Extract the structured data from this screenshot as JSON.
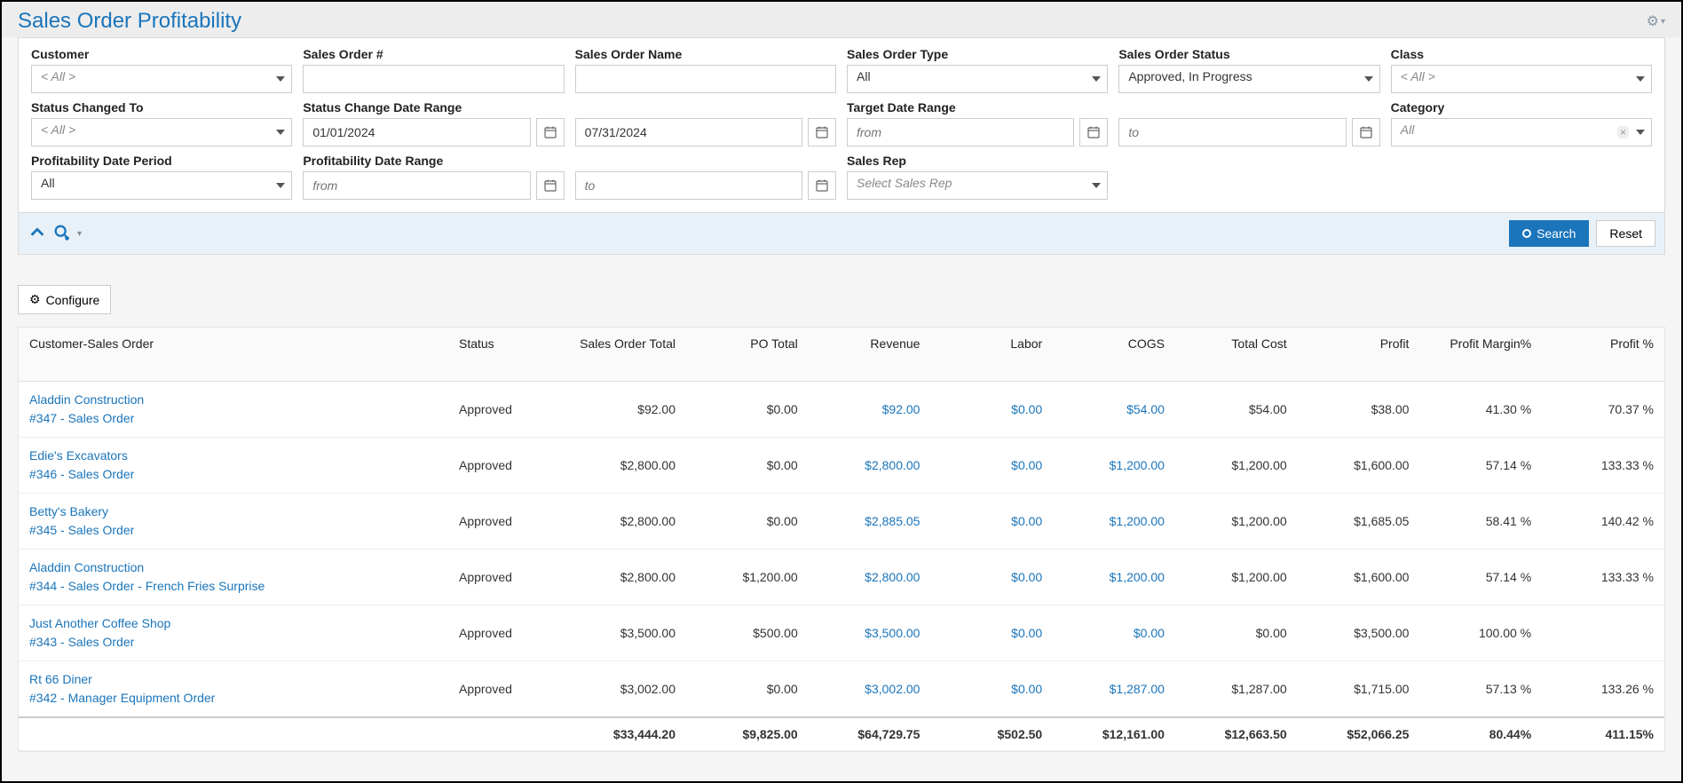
{
  "page": {
    "title": "Sales Order Profitability"
  },
  "filters": {
    "customer": {
      "label": "Customer",
      "value": "< All >"
    },
    "so_number": {
      "label": "Sales Order #",
      "value": ""
    },
    "so_name": {
      "label": "Sales Order Name",
      "value": ""
    },
    "so_type": {
      "label": "Sales Order Type",
      "value": "All"
    },
    "so_status": {
      "label": "Sales Order Status",
      "value": "Approved, In Progress"
    },
    "klass": {
      "label": "Class",
      "value": "< All >"
    },
    "status_changed_to": {
      "label": "Status Changed To",
      "value": "< All >"
    },
    "status_change_range": {
      "label": "Status Change Date Range",
      "from": "01/01/2024",
      "to": "07/31/2024"
    },
    "target_range": {
      "label": "Target Date Range",
      "from_ph": "from",
      "to_ph": "to"
    },
    "category": {
      "label": "Category",
      "value": "All"
    },
    "profit_period": {
      "label": "Profitability Date Period",
      "value": "All"
    },
    "profit_range": {
      "label": "Profitability Date Range",
      "from_ph": "from",
      "to_ph": "to"
    },
    "sales_rep": {
      "label": "Sales Rep",
      "placeholder": "Select Sales Rep"
    }
  },
  "buttons": {
    "search": "Search",
    "reset": "Reset",
    "configure": "Configure"
  },
  "columns": {
    "customer_order": "Customer-Sales Order",
    "status": "Status",
    "so_total": "Sales Order Total",
    "po_total": "PO Total",
    "revenue": "Revenue",
    "labor": "Labor",
    "cogs": "COGS",
    "total_cost": "Total Cost",
    "profit": "Profit",
    "profit_margin": "Profit Margin%",
    "profit_pct": "Profit %"
  },
  "rows": [
    {
      "customer": "Aladdin Construction",
      "order": "#347 - Sales Order",
      "status": "Approved",
      "so_total": "$92.00",
      "po_total": "$0.00",
      "revenue": "$92.00",
      "labor": "$0.00",
      "cogs": "$54.00",
      "total_cost": "$54.00",
      "profit": "$38.00",
      "margin": "41.30 %",
      "pct": "70.37 %"
    },
    {
      "customer": "Edie's Excavators",
      "order": "#346 - Sales Order",
      "status": "Approved",
      "so_total": "$2,800.00",
      "po_total": "$0.00",
      "revenue": "$2,800.00",
      "labor": "$0.00",
      "cogs": "$1,200.00",
      "total_cost": "$1,200.00",
      "profit": "$1,600.00",
      "margin": "57.14 %",
      "pct": "133.33 %"
    },
    {
      "customer": "Betty's Bakery",
      "order": "#345 - Sales Order",
      "status": "Approved",
      "so_total": "$2,800.00",
      "po_total": "$0.00",
      "revenue": "$2,885.05",
      "labor": "$0.00",
      "cogs": "$1,200.00",
      "total_cost": "$1,200.00",
      "profit": "$1,685.05",
      "margin": "58.41 %",
      "pct": "140.42 %"
    },
    {
      "customer": "Aladdin Construction",
      "order": "#344 - Sales Order - French Fries Surprise",
      "status": "Approved",
      "so_total": "$2,800.00",
      "po_total": "$1,200.00",
      "revenue": "$2,800.00",
      "labor": "$0.00",
      "cogs": "$1,200.00",
      "total_cost": "$1,200.00",
      "profit": "$1,600.00",
      "margin": "57.14 %",
      "pct": "133.33 %"
    },
    {
      "customer": "Just Another Coffee Shop",
      "order": "#343 - Sales Order",
      "status": "Approved",
      "so_total": "$3,500.00",
      "po_total": "$500.00",
      "revenue": "$3,500.00",
      "labor": "$0.00",
      "cogs": "$0.00",
      "total_cost": "$0.00",
      "profit": "$3,500.00",
      "margin": "100.00 %",
      "pct": ""
    },
    {
      "customer": "Rt 66 Diner",
      "order": "#342 - Manager Equipment Order",
      "status": "Approved",
      "so_total": "$3,002.00",
      "po_total": "$0.00",
      "revenue": "$3,002.00",
      "labor": "$0.00",
      "cogs": "$1,287.00",
      "total_cost": "$1,287.00",
      "profit": "$1,715.00",
      "margin": "57.13 %",
      "pct": "133.26 %"
    }
  ],
  "totals": {
    "so_total": "$33,444.20",
    "po_total": "$9,825.00",
    "revenue": "$64,729.75",
    "labor": "$502.50",
    "cogs": "$12,161.00",
    "total_cost": "$12,663.50",
    "profit": "$52,066.25",
    "margin": "80.44%",
    "pct": "411.15%"
  }
}
